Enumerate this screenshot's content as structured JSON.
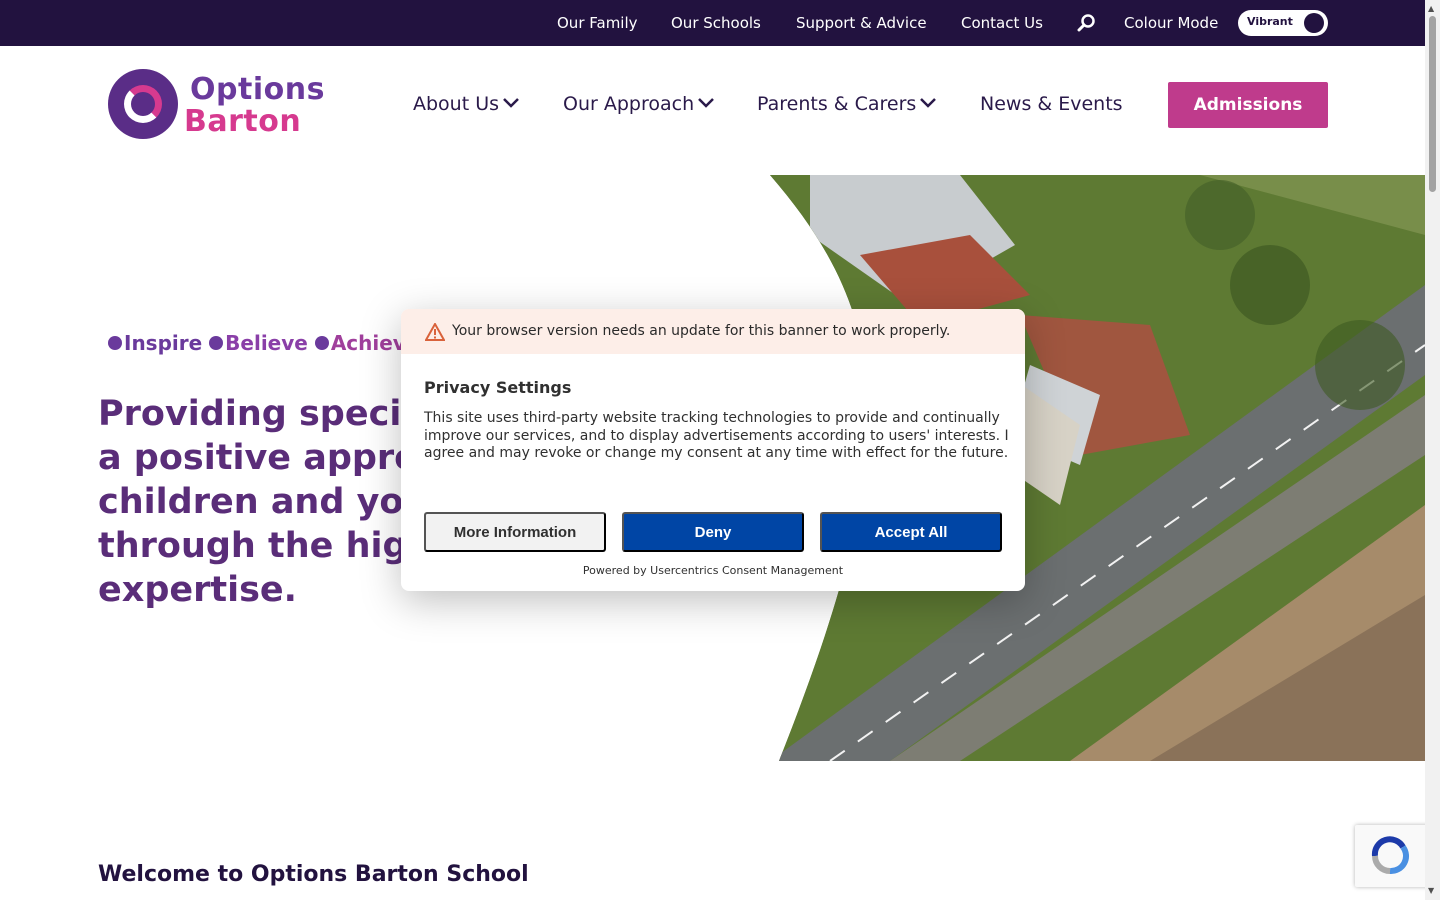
{
  "topbar": {
    "links": [
      "Our Family",
      "Our Schools",
      "Support & Advice",
      "Contact Us"
    ],
    "colour_mode_label": "Colour Mode",
    "toggle_label": "Vibrant",
    "search_icon": "search-icon"
  },
  "logo": {
    "line1": "Options",
    "line2": "Barton"
  },
  "nav": {
    "items": [
      "About Us",
      "Our Approach",
      "Parents & Carers",
      "News & Events"
    ],
    "cta": "Admissions"
  },
  "hero": {
    "tagline": [
      "Inspire",
      "Believe",
      "Achieve"
    ],
    "headline": "Providing specialist education and a positive approach to autism, for children and young people through the highest levels of expertise."
  },
  "welcome_heading": "Welcome to Options Barton School",
  "consent": {
    "warning": "Your browser version needs an update for this banner to work properly.",
    "title": "Privacy Settings",
    "body": "This site uses third-party website tracking technologies to provide and continually improve our services, and to display advertisements according to users' interests. I agree and may revoke or change my consent at any time with effect for the future.",
    "buttons": {
      "more": "More Information",
      "deny": "Deny",
      "accept": "Accept All"
    },
    "powered_by": "Powered by Usercentrics Consent Management"
  },
  "colors": {
    "topbar_bg": "#22123f",
    "brand_purple": "#5a2d79",
    "brand_pink": "#bf3b8c",
    "consent_blue": "#0045a5"
  }
}
